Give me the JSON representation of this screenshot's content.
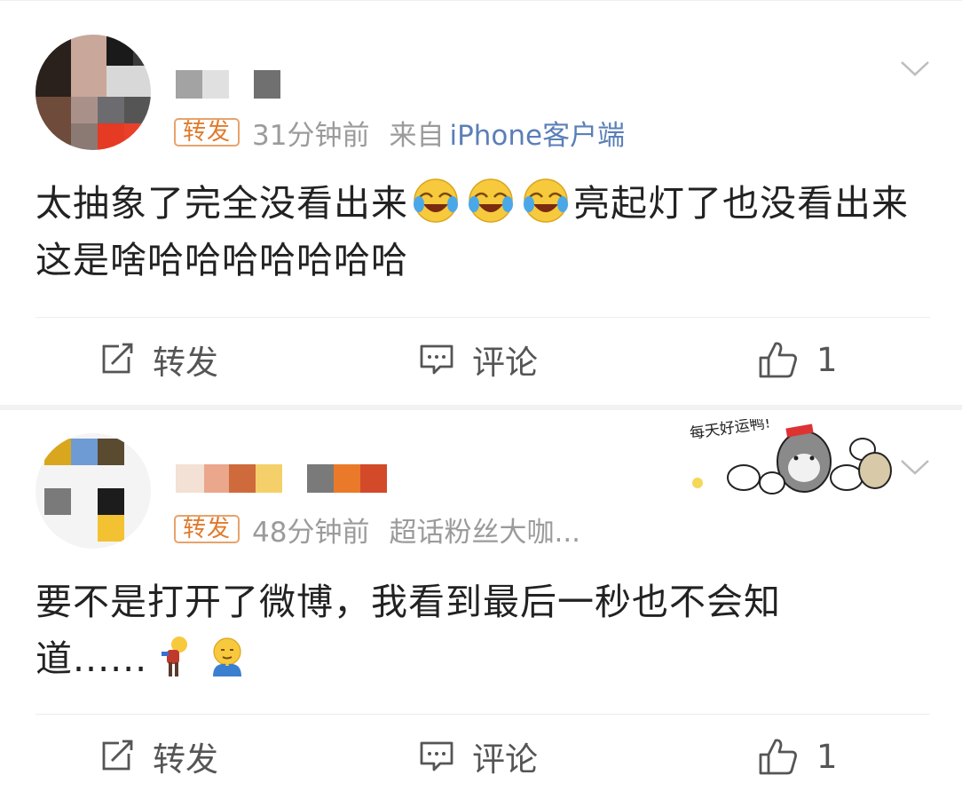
{
  "posts": [
    {
      "repost_tag": "转发",
      "time": "31分钟前",
      "source_label": "来自",
      "source_link": "iPhone客户端",
      "text": "太抽象了完全没看出来",
      "text_after_emoji": "亮起灯了也没看出来这是啥哈哈哈哈哈哈哈",
      "actions": {
        "repost": "转发",
        "comment": "评论",
        "like_count": "1"
      }
    },
    {
      "repost_tag": "转发",
      "time": "48分钟前",
      "source_text": "超话粉丝大咖...",
      "text": "要不是打开了微博，我看到最后一秒也不会知道......",
      "sticker_text": "每天好运鸭!",
      "actions": {
        "repost": "转发",
        "comment": "评论",
        "like_count": "1"
      }
    }
  ],
  "icons": {
    "chevron": "chevron-down-icon",
    "repost": "repost-icon",
    "comment": "comment-icon",
    "like": "thumbs-up-icon",
    "emoji_laugh": "laugh-cry-emoji",
    "emoji_shrug": "shrug-emoji",
    "emoji_pray": "pray-emoji"
  },
  "colors": {
    "tag_border": "#e8a36b",
    "tag_text": "#e07a2c",
    "link": "#5b7fb8",
    "meta_text": "#9b9b9b"
  }
}
